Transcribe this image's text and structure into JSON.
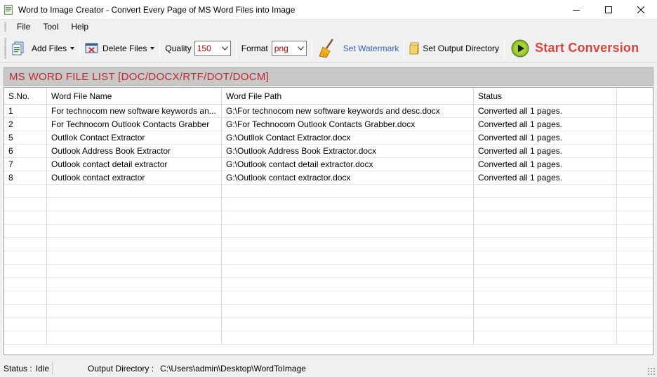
{
  "window": {
    "title": "Word to Image Creator - Convert Every Page of MS Word Files into Image"
  },
  "menu": [
    "File",
    "Tool",
    "Help"
  ],
  "toolbar": {
    "add_files": "Add Files",
    "delete_files": "Delete Files",
    "quality_label": "Quality",
    "quality_value": "150",
    "format_label": "Format",
    "format_value": "png",
    "set_watermark": "Set Watermark",
    "set_output_directory": "Set Output Directory",
    "start_conversion": "Start Conversion"
  },
  "list": {
    "header": "MS WORD FILE LIST [DOC/DOCX/RTF/DOT/DOCM]",
    "columns": [
      "S.No.",
      "Word File Name",
      "Word File Path",
      "Status"
    ],
    "rows": [
      [
        "1",
        "For technocom new software keywords an...",
        "G:\\For technocom new software keywords and desc.docx",
        "Converted all 1 pages."
      ],
      [
        "2",
        "For Technocom Outlook Contacts Grabber",
        "G:\\For Technocom Outlook Contacts Grabber.docx",
        "Converted all 1 pages."
      ],
      [
        "5",
        "Outllok Contact Extractor",
        "G:\\Outllok Contact Extractor.docx",
        "Converted all 1 pages."
      ],
      [
        "6",
        "Outlook Address Book Extractor",
        "G:\\Outlook Address Book Extractor.docx",
        "Converted all 1 pages."
      ],
      [
        "7",
        "Outlook contact detail extractor",
        "G:\\Outlook contact detail extractor.docx",
        "Converted all 1 pages."
      ],
      [
        "8",
        "Outlook contact extractor",
        "G:\\Outlook contact extractor.docx",
        "Converted all 1 pages."
      ]
    ]
  },
  "statusbar": {
    "status_label": "Status :",
    "status_value": "Idle",
    "output_label": "Output Directory :",
    "output_value": "C:\\Users\\admin\\Desktop\\WordToImage"
  },
  "colors": {
    "accent_red": "#c0272d",
    "start_red": "#d9453d",
    "link_blue": "#2f63c8"
  }
}
